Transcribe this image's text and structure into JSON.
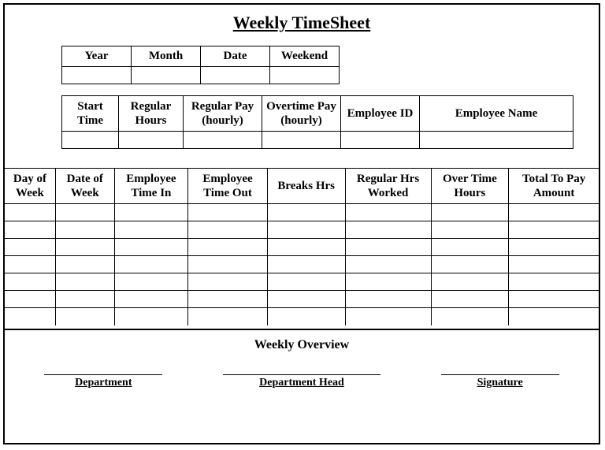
{
  "title": "Weekly TimeSheet",
  "dateTable": {
    "headers": [
      "Year",
      "Month",
      "Date",
      "Weekend"
    ],
    "values": [
      "",
      "",
      "",
      ""
    ]
  },
  "infoTable": {
    "headers": [
      "Start Time",
      "Regular Hours",
      "Regular Pay (hourly)",
      "Overtime Pay (hourly)",
      "Employee ID",
      "Employee Name"
    ],
    "values": [
      "",
      "",
      "",
      "",
      "",
      ""
    ]
  },
  "logTable": {
    "headers": [
      "Day of Week",
      "Date of Week",
      "Employee Time In",
      "Employee Time Out",
      "Breaks Hrs",
      "Regular Hrs Worked",
      "Over Time Hours",
      "Total To Pay Amount"
    ],
    "rows": [
      [
        "",
        "",
        "",
        "",
        "",
        "",
        "",
        ""
      ],
      [
        "",
        "",
        "",
        "",
        "",
        "",
        "",
        ""
      ],
      [
        "",
        "",
        "",
        "",
        "",
        "",
        "",
        ""
      ],
      [
        "",
        "",
        "",
        "",
        "",
        "",
        "",
        ""
      ],
      [
        "",
        "",
        "",
        "",
        "",
        "",
        "",
        ""
      ],
      [
        "",
        "",
        "",
        "",
        "",
        "",
        "",
        ""
      ],
      [
        "",
        "",
        "",
        "",
        "",
        "",
        "",
        ""
      ]
    ]
  },
  "footer": {
    "overview": "Weekly Overview",
    "sig1": "Department",
    "sig2": "Department Head",
    "sig3": "Signature"
  }
}
